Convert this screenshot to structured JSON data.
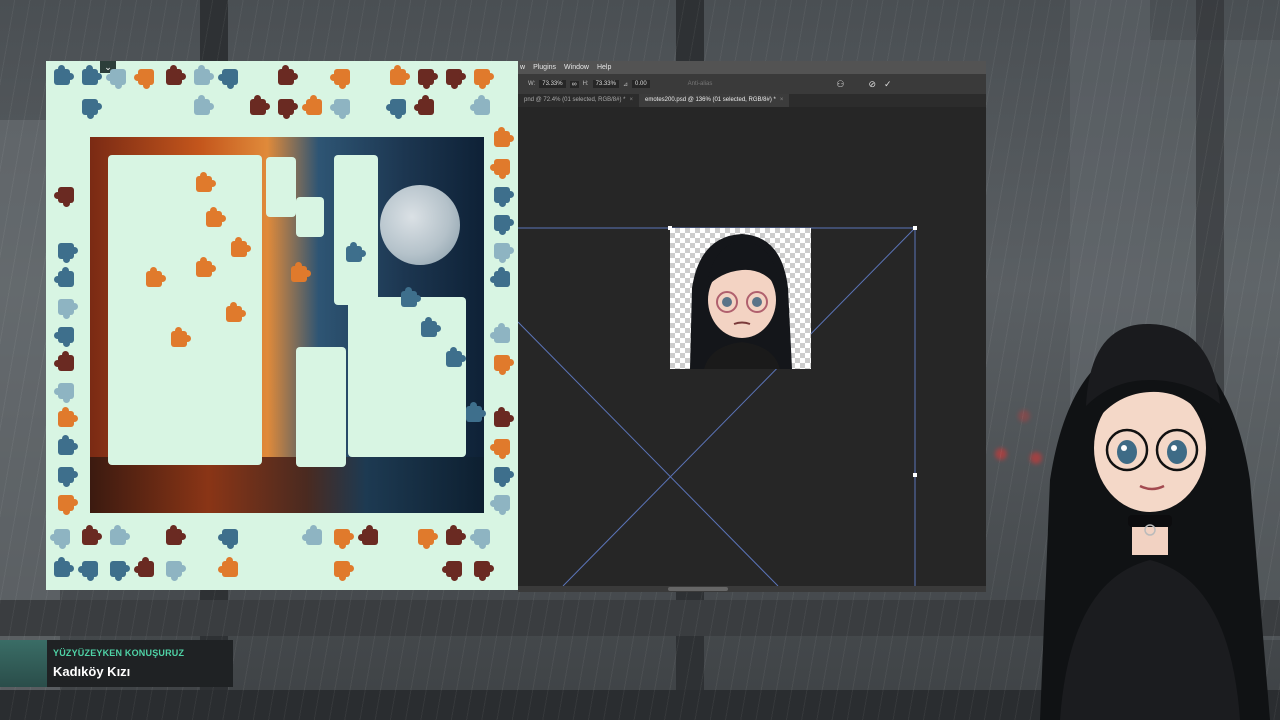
{
  "puzzle_panel": {
    "collapse_icon": "chevron-double-down-icon"
  },
  "photoshop": {
    "menu": [
      "w",
      "Plugins",
      "Window",
      "Help"
    ],
    "options": {
      "width_label": "W:",
      "width_value": "73.33%",
      "link_icon": "link-icon",
      "height_label": "H:",
      "height_value": "73.33%",
      "angle_label": "⊿",
      "angle_value": "0.00",
      "interpolation_label": "Anti-alias",
      "warp_icon": "warp-icon",
      "cancel_icon": "cancel-icon",
      "commit_icon": "checkmark-icon"
    },
    "tabs": [
      {
        "label": "pnd @ 72.4% (01 selected, RGB/8#) *",
        "active": false
      },
      {
        "label": "emotes200.psd @ 136% (01 selected, RGB/8#) *",
        "active": true
      }
    ]
  },
  "name_card": {
    "subtitle": "YÜZYÜZEYKEN KONUŞURUZ",
    "title": "Kadıköy Kızı"
  },
  "colors": {
    "puzzle_bg": "#d8f5e3",
    "ps_canvas": "#262626",
    "transform_line": "#5b74b8",
    "name_accent": "#4fd3a6"
  }
}
